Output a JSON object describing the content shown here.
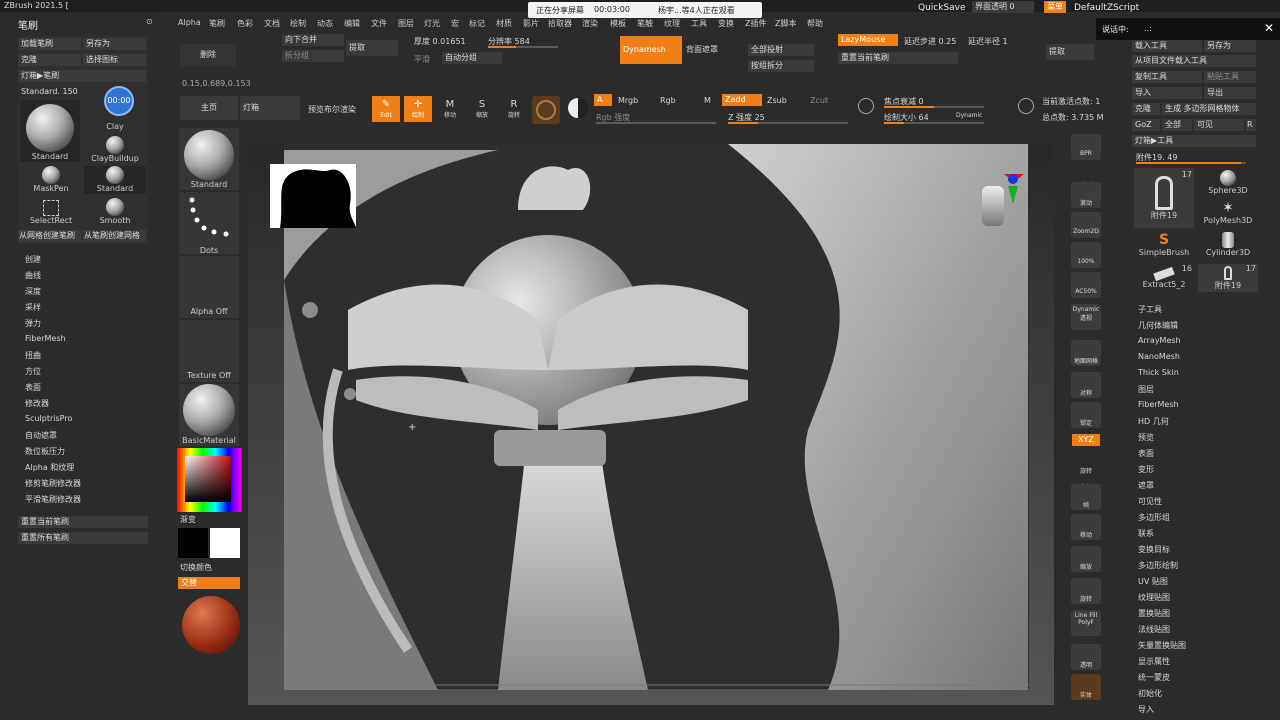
{
  "app": {
    "title": "ZBrush 2021.5 [",
    "panel_title": "笔刷"
  },
  "share_banner": {
    "sharing": "正在分享屏幕",
    "timer": "00:03:00",
    "watchers": "杨宇...等4人正在观看"
  },
  "top_right": {
    "quicksave": "QuickSave",
    "ui_opacity": "界面透明 0",
    "menu": "菜单",
    "script": "DefaultZScript"
  },
  "menubar": [
    "Alpha",
    "笔刷",
    "色彩",
    "文档",
    "绘制",
    "动态",
    "编辑",
    "文件",
    "图层",
    "灯光",
    "宏",
    "标记",
    "材质",
    "影片",
    "拾取器",
    "渲染",
    "模板",
    "笔触",
    "纹理",
    "工具",
    "变换",
    "Z插件",
    "Z脚本",
    "帮助"
  ],
  "left_panel": {
    "top_buttons": [
      "加载笔刷",
      "另存为",
      "克隆",
      "选择图标",
      "灯箱▶笔刷"
    ],
    "standard_label": "Standard. 150",
    "timer_badge": "00:00",
    "brushes": [
      "Standard",
      "Clay",
      "ClayBuildup",
      "MaskPen",
      "Standard",
      "SelectRect",
      "Smooth"
    ],
    "create_buttons": [
      "从网格创建笔刷",
      "从笔刷创建网格"
    ],
    "sections": [
      "创建",
      "曲线",
      "深度",
      "采样",
      "弹力",
      "FiberMesh",
      "扭曲",
      "方位",
      "表面",
      "修改器",
      "SculptrisPro",
      "自动遮罩",
      "数位板压力",
      "Alpha 和纹理",
      "修剪笔刷修改器",
      "平滑笔刷修改器"
    ],
    "reset_buttons": [
      "重置当前笔刷",
      "重置所有笔刷"
    ]
  },
  "left_shelf": {
    "items": [
      "Standard",
      "Dots",
      "Alpha Off",
      "Texture Off",
      "BasicMaterial"
    ],
    "gradient_label": "渐变",
    "switch_color": "切换颜色",
    "swap": "交替"
  },
  "top_toolbar": {
    "delete": "删除",
    "merge_down": "向下合并",
    "split_visible": "拆分组",
    "extract": "提取",
    "thickness": "厚度 0.01651",
    "resolution": "分辨率 584",
    "smooth": "平滑",
    "auto_groups": "自动分组",
    "dynamesh": "Dynamesh",
    "back_mask": "背面遮罩",
    "project_all": "全部投射",
    "split_by_groups": "按组拆分",
    "lazymouse": "LazyMouse",
    "lazy_step": "延迟步进 0.25",
    "lazy_radius": "延迟半径 1",
    "reset_brush": "重置当前笔刷",
    "extract2": "提取",
    "coords": "0.15,0.689,0.153"
  },
  "second_toolbar": {
    "home": "主页",
    "lightbox": "灯箱",
    "bpr": "预览布尔渲染",
    "edit": "Edit",
    "draw": "绘制",
    "move": "移动",
    "scale": "缩放",
    "rotate": "旋转",
    "a": "A",
    "mrgb": "Mrgb",
    "rgb": "Rgb",
    "m": "M",
    "rgb_intensity": "Rgb 强度",
    "zadd": "Zadd",
    "zsub": "Zsub",
    "zcut": "Zcut",
    "z_intensity": "Z 强度 25",
    "focal_shift": "焦点衰减 0",
    "draw_size": "绘制大小 64",
    "dynamic": "Dynamic",
    "active_points": "当前激活点数: 1",
    "total_points": "总点数: 3.735 M"
  },
  "right_icons": [
    "BPR",
    "子像素",
    "滚动",
    "Zoom2D",
    "100%",
    "AC50%",
    "Dynamic 透视",
    "地面网格",
    "对称",
    "锁定",
    "XYZ",
    "旋转",
    "旋转",
    "帧",
    "移动",
    "缩放",
    "旋转",
    "Line Fill PolyF",
    "透明",
    "实体"
  ],
  "right_panel": {
    "dialog_label": "说话中:",
    "dialog_suffix": "..:",
    "buttons": [
      "载入工具",
      "另存为",
      "从项目文件载入工具",
      "复制工具",
      "粘贴工具",
      "导入",
      "导出",
      "克隆",
      "生成 多边形网格物体",
      "GoZ",
      "全部",
      "可见",
      "R",
      "灯箱▶工具"
    ],
    "subtool_label": "附件19. 49",
    "tools": [
      {
        "name": "附件19",
        "count": "17"
      },
      {
        "name": "Sphere3D",
        "count": ""
      },
      {
        "name": "PolyMesh3D",
        "count": ""
      },
      {
        "name": "SimpleBrush",
        "count": ""
      },
      {
        "name": "Cylinder3D",
        "count": ""
      },
      {
        "name": "Extract5_2",
        "count": "16"
      },
      {
        "name": "附件19",
        "count": "17"
      }
    ],
    "sections": [
      "子工具",
      "几何体编辑",
      "ArrayMesh",
      "NanoMesh",
      "Thick Skin",
      "图层",
      "FiberMesh",
      "HD 几何",
      "预览",
      "表面",
      "变形",
      "遮罩",
      "可见性",
      "多边形组",
      "联系",
      "变换目标",
      "多边形绘制",
      "UV 贴图",
      "纹理贴图",
      "置换贴图",
      "法线贴图",
      "矢量置换贴图",
      "显示属性",
      "统一蒙皮",
      "初始化",
      "导入"
    ]
  },
  "colors": {
    "accent": "#f07f16",
    "panel": "#313131",
    "background": "#2b2b2b"
  }
}
